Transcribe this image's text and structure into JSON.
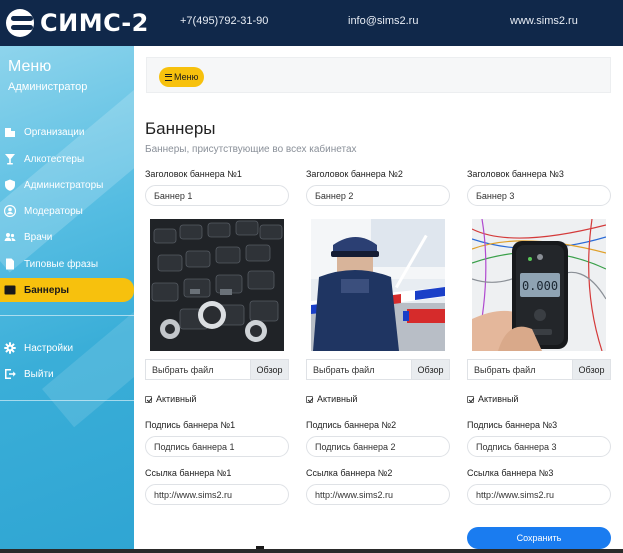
{
  "header": {
    "logo_text": "СИМС-2",
    "phone": "+7(495)792-31-90",
    "email": "info@sims2.ru",
    "site": "www.sims2.ru",
    "bg_color": "#10284a"
  },
  "sidebar": {
    "title": "Меню",
    "role": "Администратор",
    "items": [
      {
        "label": "Организации",
        "icon": "building-icon"
      },
      {
        "label": "Алкотестеры",
        "icon": "cocktail-icon"
      },
      {
        "label": "Администраторы",
        "icon": "shield-icon"
      },
      {
        "label": "Модераторы",
        "icon": "user-circle-icon"
      },
      {
        "label": "Врачи",
        "icon": "users-icon"
      },
      {
        "label": "Типовые фразы",
        "icon": "file-icon"
      },
      {
        "label": "Баннеры",
        "icon": "image-icon",
        "active": true
      }
    ],
    "bottom_items": [
      {
        "label": "Настройки",
        "icon": "gear-icon"
      },
      {
        "label": "Выйти",
        "icon": "sign-out-icon"
      }
    ],
    "active_color": "#f7c10d"
  },
  "main": {
    "menu_button": "Меню",
    "title": "Баннеры",
    "subtitle": "Баннеры, присутствующие во всех кабинетах",
    "banners": [
      {
        "title_label": "Заголовок баннера №1",
        "title_value": "Баннер 1",
        "file_placeholder": "Выбрать файл",
        "browse": "Обзор",
        "active_label": "Активный",
        "caption_label": "Подпись баннера №1",
        "caption_value": "Подпись баннера 1",
        "link_label": "Ссылка баннера №1",
        "link_value": "http://www.sims2.ru"
      },
      {
        "title_label": "Заголовок баннера №2",
        "title_value": "Баннер 2",
        "file_placeholder": "Выбрать файл",
        "browse": "Обзор",
        "active_label": "Активный",
        "caption_label": "Подпись баннера №2",
        "caption_value": "Подпись баннера 2",
        "link_label": "Ссылка баннера №2",
        "link_value": "http://www.sims2.ru"
      },
      {
        "title_label": "Заголовок баннера №3",
        "title_value": "Баннер 3",
        "file_placeholder": "Выбрать файл",
        "browse": "Обзор",
        "active_label": "Активный",
        "caption_label": "Подпись баннера №3",
        "caption_value": "Подпись баннера 3",
        "link_label": "Ссылка баннера №3",
        "link_value": "http://www.sims2.ru"
      }
    ],
    "save_button": "Сохранить",
    "save_color": "#1a7cf0",
    "device_display": "0.000"
  }
}
